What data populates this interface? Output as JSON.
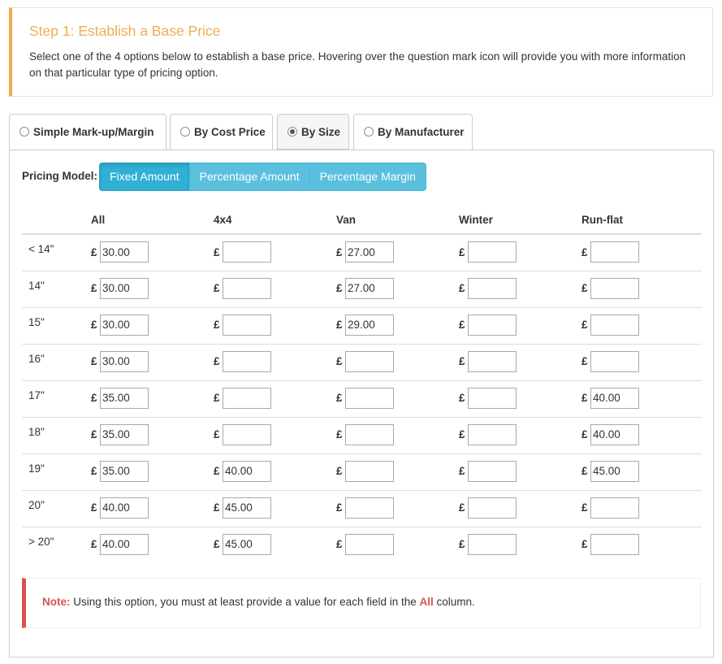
{
  "step": {
    "title": "Step 1: Establish a Base Price",
    "description": "Select one of the 4 options below to establish a base price. Hovering over the question mark icon will provide you with more information on that particular type of pricing option."
  },
  "tabs": [
    {
      "label": "Simple Mark-up/Margin",
      "selected": false
    },
    {
      "label": "By Cost Price",
      "selected": false
    },
    {
      "label": "By Size",
      "selected": true
    },
    {
      "label": "By Manufacturer",
      "selected": false
    }
  ],
  "pricing_model": {
    "label": "Pricing Model:",
    "options": [
      "Fixed Amount",
      "Percentage Amount",
      "Percentage Margin"
    ],
    "selected": "Fixed Amount"
  },
  "table": {
    "currency": "£",
    "columns": [
      "All",
      "4x4",
      "Van",
      "Winter",
      "Run-flat"
    ],
    "rows": [
      {
        "size": "< 14\"",
        "values": [
          "30.00",
          "",
          "27.00",
          "",
          ""
        ]
      },
      {
        "size": "14\"",
        "values": [
          "30.00",
          "",
          "27.00",
          "",
          ""
        ]
      },
      {
        "size": "15\"",
        "values": [
          "30.00",
          "",
          "29.00",
          "",
          ""
        ]
      },
      {
        "size": "16\"",
        "values": [
          "30.00",
          "",
          "",
          "",
          ""
        ]
      },
      {
        "size": "17\"",
        "values": [
          "35.00",
          "",
          "",
          "",
          "40.00"
        ]
      },
      {
        "size": "18\"",
        "values": [
          "35.00",
          "",
          "",
          "",
          "40.00"
        ]
      },
      {
        "size": "19\"",
        "values": [
          "35.00",
          "40.00",
          "",
          "",
          "45.00"
        ]
      },
      {
        "size": "20\"",
        "values": [
          "40.00",
          "45.00",
          "",
          "",
          ""
        ]
      },
      {
        "size": "> 20\"",
        "values": [
          "40.00",
          "45.00",
          "",
          "",
          ""
        ]
      }
    ]
  },
  "note": {
    "label": "Note:",
    "text_before": " Using this option, you must at least provide a value for each field in the ",
    "highlight": "All",
    "text_after": " column."
  },
  "colors": {
    "accent_orange": "#f0ad4e",
    "info_blue": "#5bc0de",
    "danger_red": "#d9534f"
  }
}
